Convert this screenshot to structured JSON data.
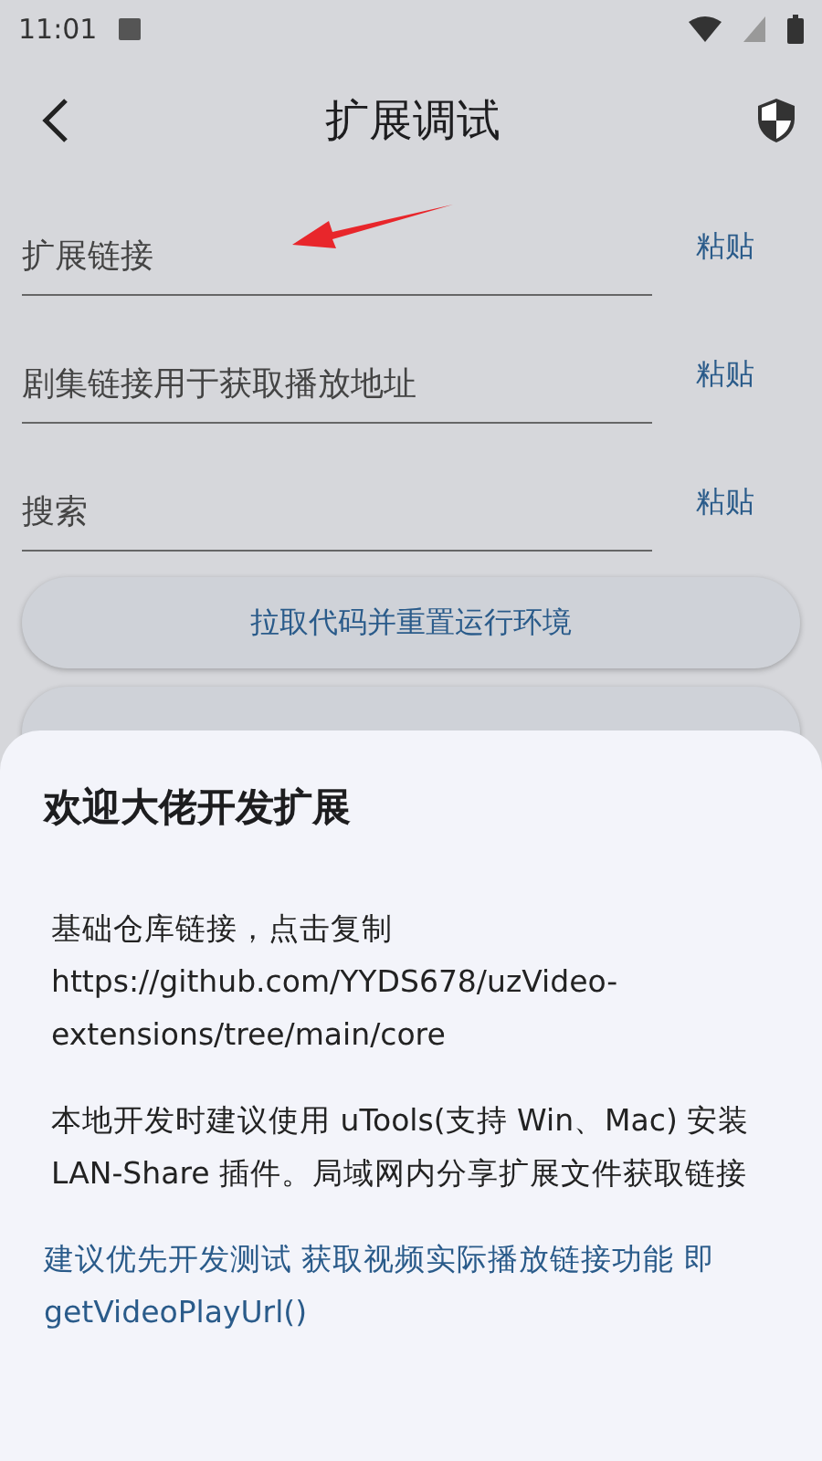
{
  "status_bar": {
    "time": "11:01"
  },
  "app_bar": {
    "title": "扩展调试"
  },
  "fields": [
    {
      "placeholder": "扩展链接",
      "action": "粘贴"
    },
    {
      "placeholder": "剧集链接用于获取播放地址",
      "action": "粘贴"
    },
    {
      "placeholder": "搜索",
      "action": "粘贴"
    }
  ],
  "buttons": [
    "拉取代码并重置运行环境"
  ],
  "sheet": {
    "title": "欢迎大佬开发扩展",
    "paragraphs": [
      {
        "kind": "plain",
        "lines": [
          "基础仓库链接，点击复制",
          "https://github.com/YYDS678/uzVideo-extensions/tree/main/core"
        ]
      },
      {
        "kind": "plain",
        "lines": [
          "本地开发时建议使用 uTools(支持 Win、Mac) 安装 LAN-Share 插件。局域网内分享扩展文件获取链接"
        ]
      },
      {
        "kind": "link",
        "lines": [
          "建议优先开发测试 获取视频实际播放链接功能 即 getVideoPlayUrl()"
        ]
      }
    ]
  }
}
